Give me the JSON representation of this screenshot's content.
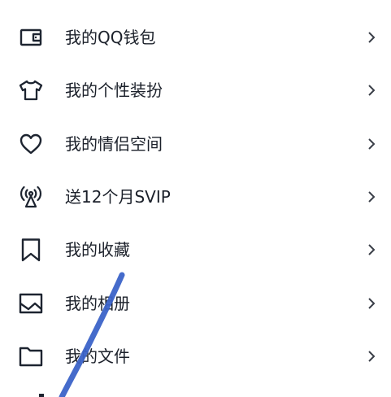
{
  "menu": {
    "items": [
      {
        "label": "我的QQ钱包",
        "icon": "wallet-icon"
      },
      {
        "label": "我的个性装扮",
        "icon": "tshirt-icon"
      },
      {
        "label": "我的情侣空间",
        "icon": "heart-icon"
      },
      {
        "label": "送12个月SVIP",
        "icon": "broadcast-antenna-icon"
      },
      {
        "label": "我的收藏",
        "icon": "bookmark-icon"
      },
      {
        "label": "我的相册",
        "icon": "picture-icon"
      },
      {
        "label": "我的文件",
        "icon": "folder-icon"
      }
    ],
    "chevron": "›"
  },
  "colors": {
    "text": "#1b202a",
    "icon": "#1d2430",
    "chevron": "#3a3f48",
    "annotation_stroke": "#3b63c8",
    "background": "#ffffff"
  }
}
